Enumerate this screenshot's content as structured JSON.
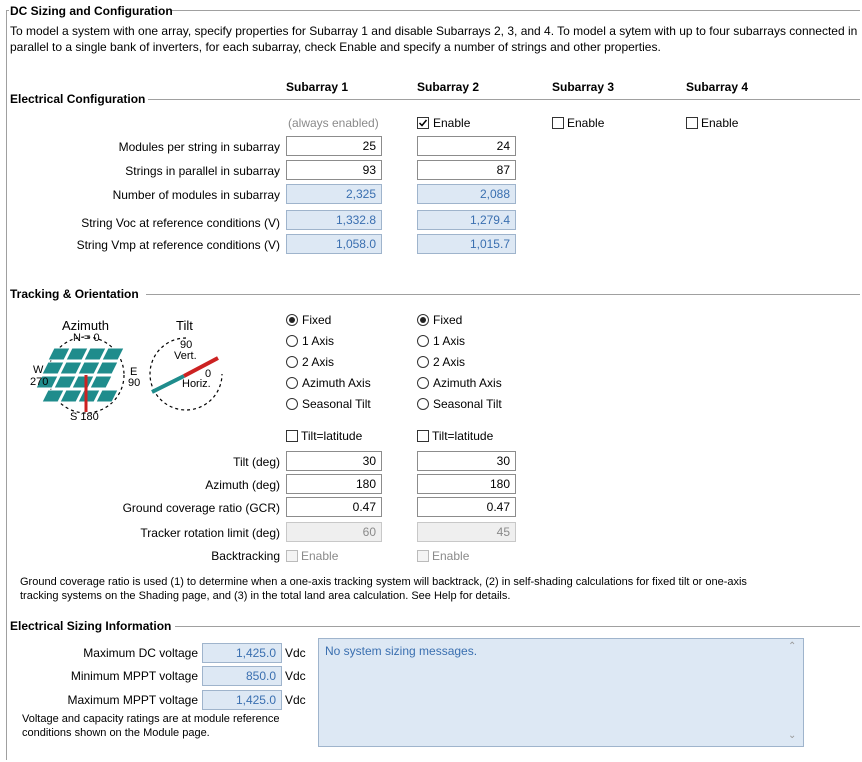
{
  "header": {
    "title": "DC Sizing and Configuration",
    "description_line1": "To model a system with one array, specify properties for Subarray 1 and disable Subarrays 2, 3, and 4.  To model a sytem with up to four subarrays connected in",
    "description_line2": "parallel to a single bank of inverters, for each subarray, check Enable and specify a number of strings and other properties."
  },
  "columns": [
    "Subarray 1",
    "Subarray 2",
    "Subarray 3",
    "Subarray 4"
  ],
  "electrical": {
    "section_title": "Electrical Configuration",
    "always_enabled": "(always enabled)",
    "enable_label": "Enable",
    "enabled": [
      true,
      true,
      false,
      false
    ],
    "rows": [
      {
        "label": "Modules per string in subarray",
        "values": [
          "25",
          "24"
        ]
      },
      {
        "label": "Strings in parallel in subarray",
        "values": [
          "93",
          "87"
        ]
      },
      {
        "label": "Number of modules in subarray",
        "values": [
          "2,325",
          "2,088"
        ]
      },
      {
        "label": "String Voc at reference conditions (V)",
        "values": [
          "1,332.8",
          "1,279.4"
        ]
      },
      {
        "label": "String Vmp at reference conditions (V)",
        "values": [
          "1,058.0",
          "1,015.7"
        ]
      }
    ]
  },
  "tracking": {
    "section_title": "Tracking & Orientation",
    "diagram": {
      "azimuth_title": "Azimuth",
      "tilt_title": "Tilt",
      "north": "N = 0",
      "east": "E",
      "east_deg": "90",
      "west": "W",
      "west_deg": "270",
      "south": "S 180",
      "tilt_vert_deg": "90",
      "tilt_vert": "Vert.",
      "tilt_horiz_deg": "0",
      "tilt_horiz": "Horiz."
    },
    "options": [
      "Fixed",
      "1 Axis",
      "2 Axis",
      "Azimuth Axis",
      "Seasonal Tilt"
    ],
    "selected": [
      "Fixed",
      "Fixed"
    ],
    "tilt_latitude_label": "Tilt=latitude",
    "rows": [
      {
        "label": "Tilt (deg)",
        "values": [
          "30",
          "30"
        ]
      },
      {
        "label": "Azimuth (deg)",
        "values": [
          "180",
          "180"
        ]
      },
      {
        "label": "Ground coverage ratio (GCR)",
        "values": [
          "0.47",
          "0.47"
        ]
      },
      {
        "label": "Tracker rotation limit (deg)",
        "values": [
          "60",
          "45"
        ]
      }
    ],
    "backtracking_label": "Backtracking",
    "backtracking_enable": "Enable",
    "note_line1": "Ground coverage ratio is used (1) to determine when a one-axis tracking system will backtrack, (2) in self-shading calculations for fixed tilt or one-axis",
    "note_line2": "tracking systems on the Shading page, and (3) in the total land area calculation. See Help for details."
  },
  "sizing": {
    "section_title": "Electrical Sizing Information",
    "rows": [
      {
        "label": "Maximum DC voltage",
        "value": "1,425.0",
        "unit": "Vdc"
      },
      {
        "label": "Minimum MPPT voltage",
        "value": "850.0",
        "unit": "Vdc"
      },
      {
        "label": "Maximum MPPT voltage",
        "value": "1,425.0",
        "unit": "Vdc"
      }
    ],
    "note_line1": "Voltage and capacity ratings are at module reference",
    "note_line2": "conditions shown on the Module page.",
    "messages": "No system sizing messages."
  },
  "colors": {
    "calc_bg": "#dde8f4",
    "calc_text": "#3a6fb0",
    "panel_teal": "#1f8c8c",
    "indicator_red": "#cc2222"
  }
}
